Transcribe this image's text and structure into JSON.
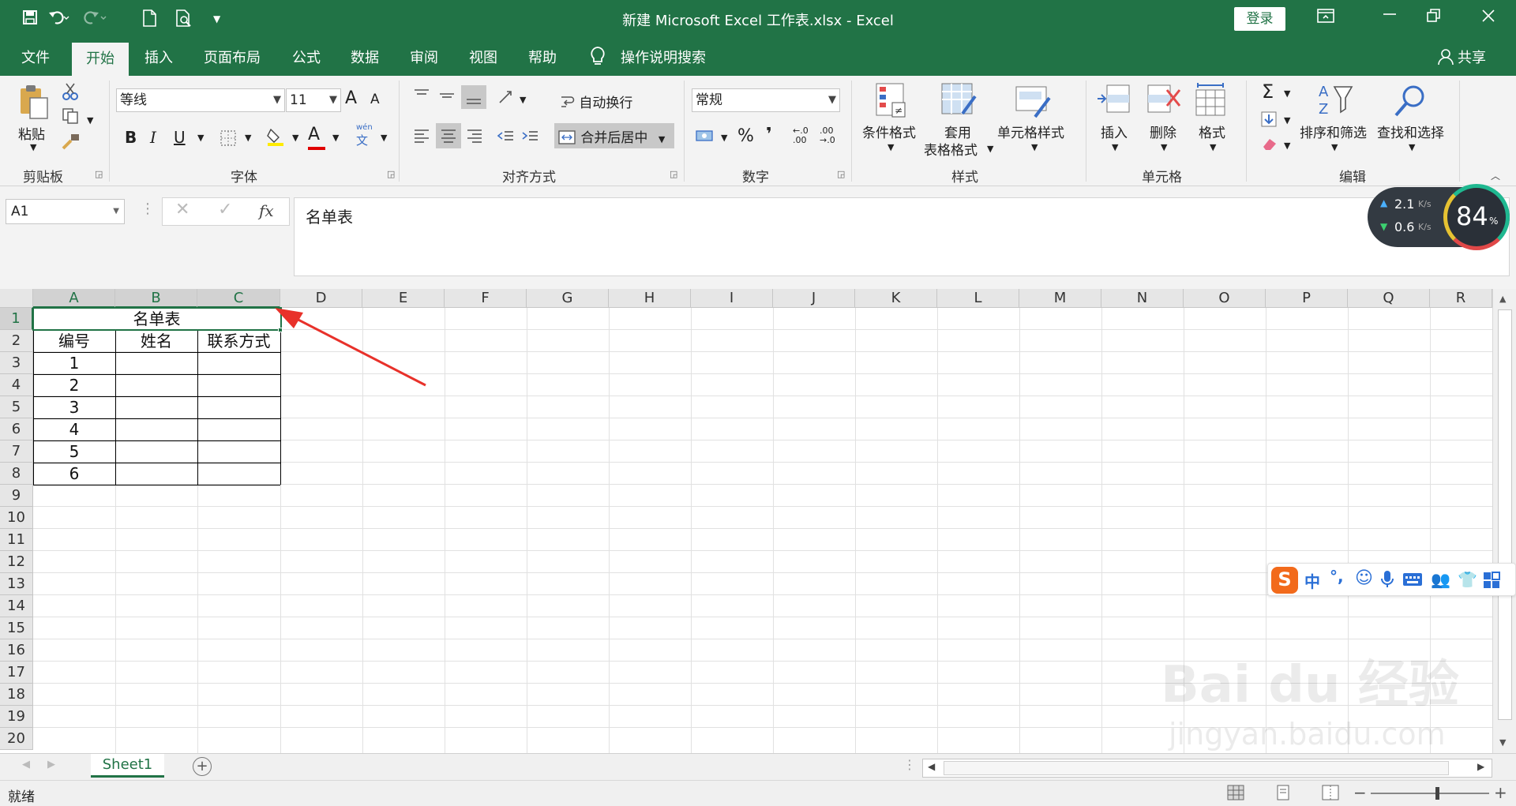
{
  "titlebar": {
    "title": "新建 Microsoft Excel 工作表.xlsx  -  Excel",
    "login": "登录"
  },
  "tabs": [
    "文件",
    "开始",
    "插入",
    "页面布局",
    "公式",
    "数据",
    "审阅",
    "视图",
    "帮助"
  ],
  "tell_me": "操作说明搜索",
  "share": "共享",
  "ribbon": {
    "clipboard": {
      "paste": "粘贴",
      "label": "剪贴板"
    },
    "font": {
      "name": "等线",
      "size": "11",
      "label": "字体",
      "bold": "B",
      "italic": "I",
      "underline": "U",
      "grow": "A",
      "shrink": "A",
      "color_a": "A",
      "wen": "wén"
    },
    "alignment": {
      "wrap": "自动换行",
      "merge": "合并后居中",
      "label": "对齐方式"
    },
    "number": {
      "format": "常规",
      "label": "数字",
      "percent": "%",
      "comma": "❜"
    },
    "styles": {
      "conditional": "条件格式",
      "table_fmt_1": "套用",
      "table_fmt_2": "表格格式",
      "cell_styles": "单元格样式",
      "label": "样式"
    },
    "cells": {
      "insert": "插入",
      "delete": "删除",
      "format": "格式",
      "label": "单元格"
    },
    "editing": {
      "sort": "排序和筛选",
      "find": "查找和选择",
      "label": "编辑"
    }
  },
  "formula_bar": {
    "name_box": "A1",
    "fx": "fx",
    "content": "名单表"
  },
  "net_widget": {
    "up": "2.1",
    "down": "0.6",
    "unit": "K/s",
    "percent": "84",
    "percent_sign": "%"
  },
  "columns": [
    "A",
    "B",
    "C",
    "D",
    "E",
    "F",
    "G",
    "H",
    "I",
    "J",
    "K",
    "L",
    "M",
    "N",
    "O",
    "P",
    "Q",
    "R"
  ],
  "rows": [
    "1",
    "2",
    "3",
    "4",
    "5",
    "6",
    "7",
    "8",
    "9",
    "10",
    "11",
    "12",
    "13",
    "14",
    "15",
    "16",
    "17",
    "18",
    "19",
    "20"
  ],
  "sheet": {
    "title": "名单表",
    "headers": [
      "编号",
      "姓名",
      "联系方式"
    ],
    "ids": [
      "1",
      "2",
      "3",
      "4",
      "5",
      "6"
    ]
  },
  "sheet_tabs": [
    "Sheet1"
  ],
  "status": "就绪",
  "ime": {
    "label": "中"
  },
  "watermark": {
    "text": "jingyan.baidu.com",
    "logo": "Bai du 经验"
  },
  "colors": {
    "excel_green": "#217346",
    "annotation_arrow": "#e8312a"
  }
}
